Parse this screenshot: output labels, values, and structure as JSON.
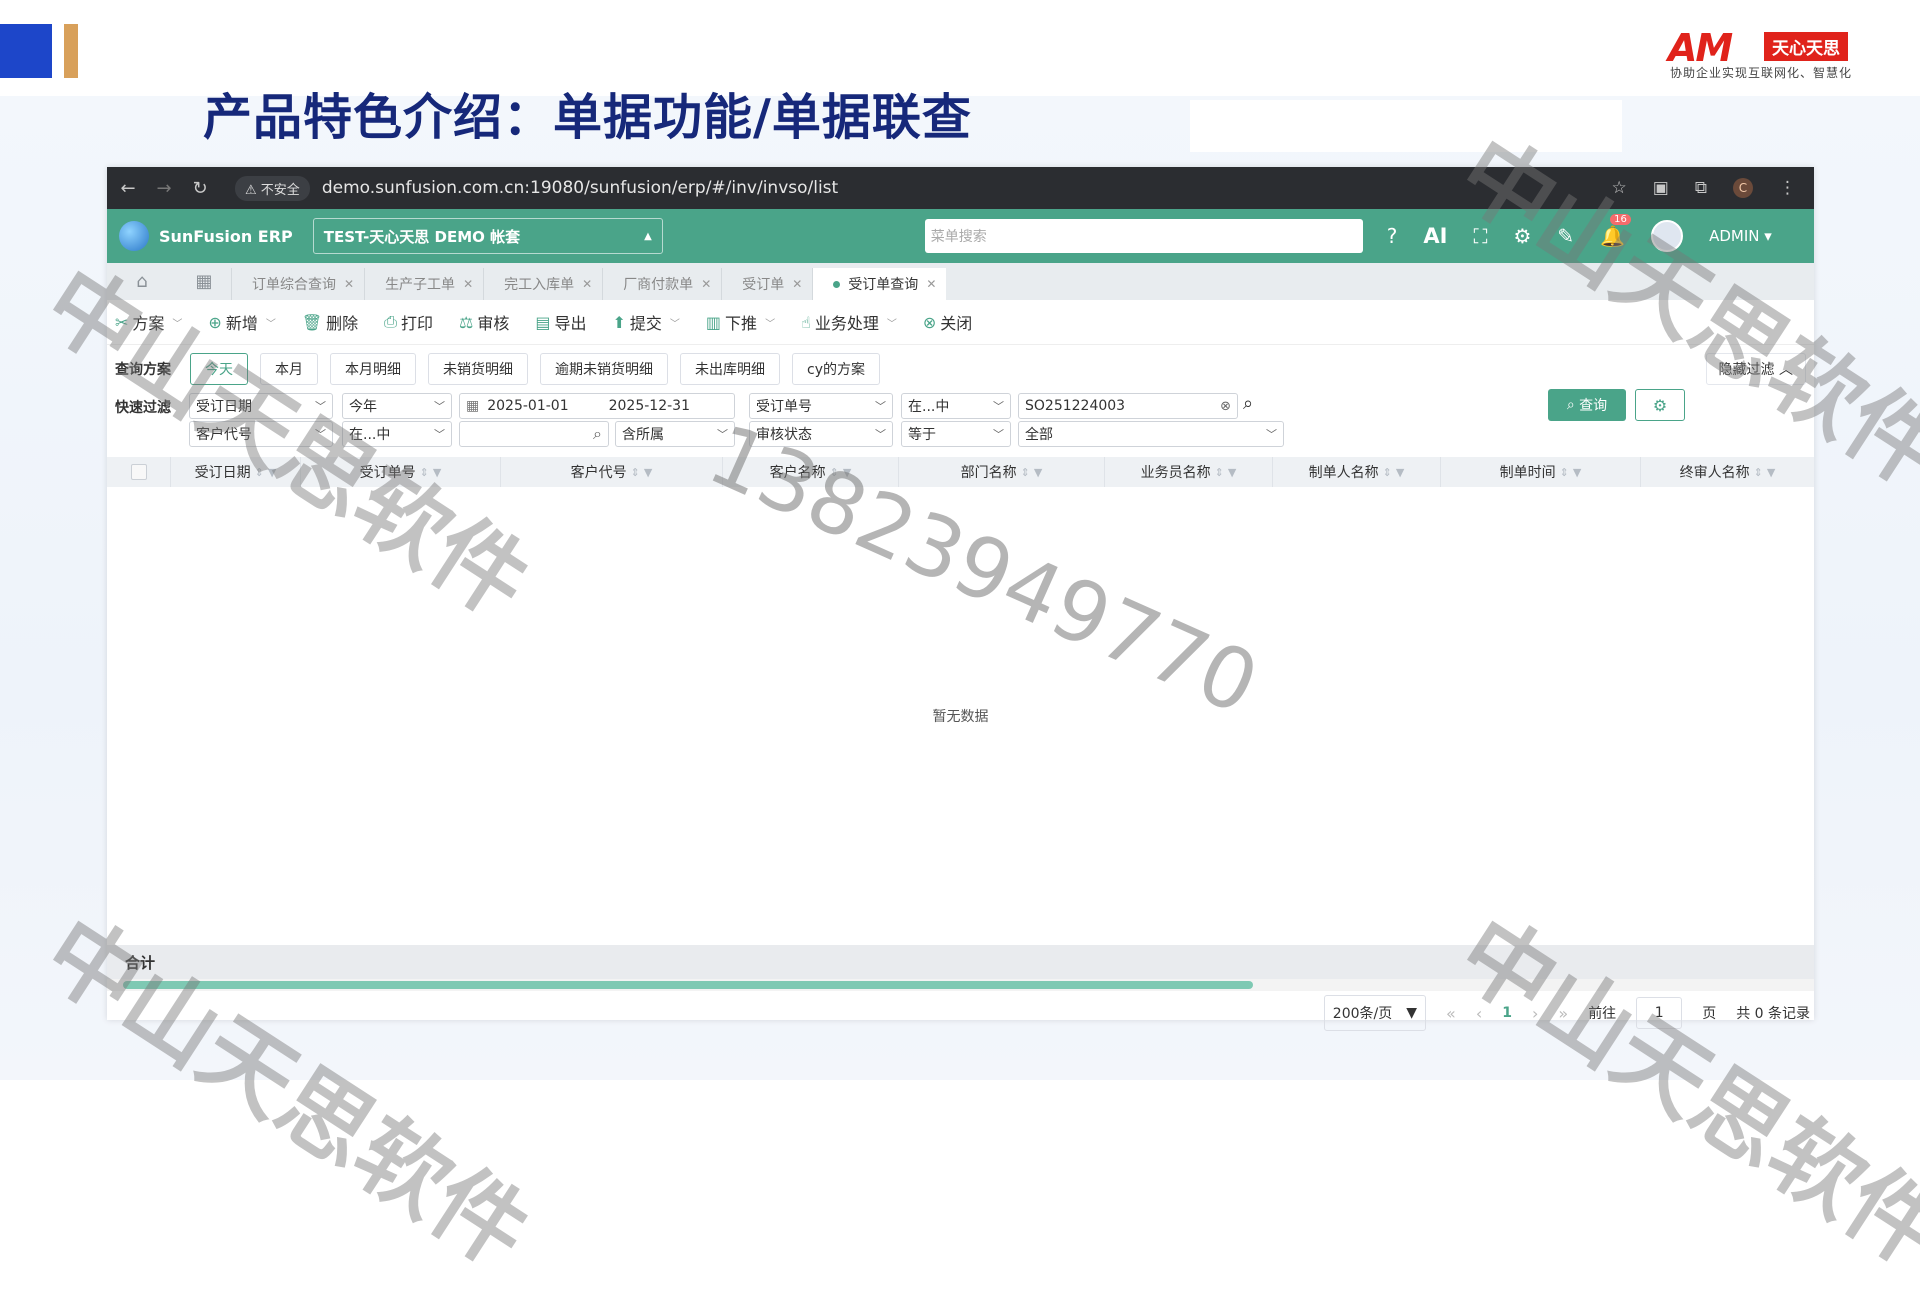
{
  "slide": {
    "title": "产品特色介绍：单据功能/单据联查",
    "logo_mark": "AM",
    "logo_brand": "天心天思",
    "logo_tagline": "协助企业实现互联网化、智慧化",
    "watermark_text": "中山天思软件",
    "watermark_phone": "13823949770",
    "accent_colors": [
      "#1d46c9",
      "#d8a05a",
      "#16287a"
    ]
  },
  "browser": {
    "insecure_label": "不安全",
    "url": "demo.sunfusion.com.cn:19080/sunfusion/erp/#/inv/invso/list",
    "profile_initial": "C"
  },
  "app": {
    "brand": "SunFusion ERP",
    "account": "TEST-天心天思 DEMO 帐套",
    "menu_search_placeholder": "菜单搜索",
    "ai_label": "AI",
    "notification_count": "16",
    "user": "ADMIN",
    "theme_color": "#4aa489"
  },
  "tabs": [
    {
      "label": "订单综合查询"
    },
    {
      "label": "生产子工单"
    },
    {
      "label": "完工入库单"
    },
    {
      "label": "厂商付款单"
    },
    {
      "label": "受订单"
    },
    {
      "label": "受订单查询"
    }
  ],
  "toolbar": {
    "scheme": "方案",
    "add": "新增",
    "delete": "删除",
    "print": "打印",
    "audit": "审核",
    "export": "导出",
    "submit": "提交",
    "push_down": "下推",
    "business": "业务处理",
    "close": "关闭"
  },
  "query": {
    "label": "查询方案",
    "chips": [
      "今天",
      "本月",
      "本月明细",
      "未销货明细",
      "逾期未销货明细",
      "未出库明细",
      "cy的方案"
    ],
    "hide_filter": "隐藏过滤"
  },
  "filter": {
    "label": "快速过滤",
    "row1": {
      "field1": "受订日期",
      "op1": "今年",
      "date_start": "2025-01-01",
      "date_end": "2025-12-31",
      "field2": "受订单号",
      "op2": "在...中",
      "value2": "SO251224003"
    },
    "row2": {
      "field1": "客户代号",
      "op1": "在...中",
      "value1": "",
      "scope": "含所属",
      "field2": "审核状态",
      "op2": "等于",
      "value2": "全部"
    },
    "query_button": "查询"
  },
  "table": {
    "columns": [
      "受订日期",
      "受订单号",
      "客户代号",
      "客户名称",
      "部门名称",
      "业务员名称",
      "制单人名称",
      "制单时间",
      "终审人名称"
    ],
    "empty_text": "暂无数据",
    "sum_label": "合计"
  },
  "pager": {
    "page_size": "200条/页",
    "current_page": "1",
    "goto_label": "前往",
    "goto_value": "1",
    "page_unit": "页",
    "total_text": "共 0 条记录"
  }
}
